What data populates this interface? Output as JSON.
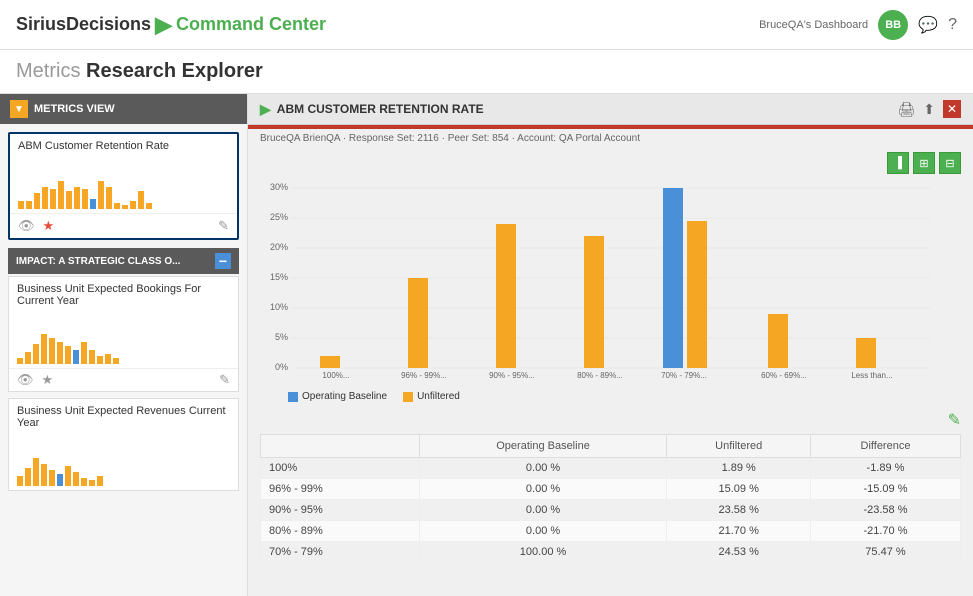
{
  "header": {
    "logo_sirius": "SiriusDecisions",
    "logo_arrow": "▶",
    "logo_command": "Command Center",
    "dashboard_label": "BruceQA's Dashboard",
    "avatar_initials": "BB",
    "chat_icon": "💬",
    "help_icon": "?"
  },
  "page_title": {
    "light": "Metrics ",
    "bold": "Research Explorer"
  },
  "sidebar": {
    "header_label": "METRICS VIEW",
    "metrics": [
      {
        "title": "ABM Customer Retention Rate",
        "selected": true
      }
    ],
    "impact_header": "IMPACT: A STRATEGIC CLASS O...",
    "impact_cards": [
      {
        "title": "Business Unit Expected Bookings For Current Year"
      },
      {
        "title": "Business Unit Expected Revenues Current Year"
      }
    ]
  },
  "panel": {
    "title": "ABM CUSTOMER RETENTION RATE",
    "chart_info": "BruceQA BrienQA · Response Set: 2116 · Peer Set: 854 · Account: QA Portal Account",
    "chart_type_icons": [
      "bar-chart-icon",
      "table-icon",
      "other-chart-icon"
    ],
    "y_axis_labels": [
      "30%",
      "25%",
      "20%",
      "15%",
      "10%",
      "5%",
      "0%"
    ],
    "x_axis_labels": [
      "100%...",
      "96% - 99%...",
      "90% - 95%...",
      "80% - 89%...",
      "70% - 79%...",
      "60% - 69%...",
      "Less than..."
    ],
    "legend": {
      "baseline_label": "Operating Baseline",
      "baseline_color": "#4a90d9",
      "unfiltered_label": "Unfiltered",
      "unfiltered_color": "#f5a623"
    },
    "chart_bars": [
      {
        "category": "100%...",
        "baseline": 0,
        "unfiltered": 2
      },
      {
        "category": "96% - 99%...",
        "baseline": 0,
        "unfiltered": 15
      },
      {
        "category": "90% - 95%...",
        "baseline": 0,
        "unfiltered": 24
      },
      {
        "category": "80% - 89%...",
        "baseline": 0,
        "unfiltered": 22
      },
      {
        "category": "70% - 79%...",
        "baseline": 100,
        "unfiltered": 24.5
      },
      {
        "category": "60% - 69%...",
        "baseline": 0,
        "unfiltered": 9
      },
      {
        "category": "Less than...",
        "baseline": 0,
        "unfiltered": 5
      }
    ],
    "table": {
      "columns": [
        "",
        "Operating Baseline",
        "Unfiltered",
        "Difference"
      ],
      "rows": [
        {
          "label": "100%",
          "baseline": "0.00 %",
          "unfiltered": "1.89 %",
          "difference": "-1.89 %"
        },
        {
          "label": "96% - 99%",
          "baseline": "0.00 %",
          "unfiltered": "15.09 %",
          "difference": "-15.09 %"
        },
        {
          "label": "90% - 95%",
          "baseline": "0.00 %",
          "unfiltered": "23.58 %",
          "difference": "-23.58 %"
        },
        {
          "label": "80% - 89%",
          "baseline": "0.00 %",
          "unfiltered": "21.70 %",
          "difference": "-21.70 %"
        },
        {
          "label": "70% - 79%",
          "baseline": "100.00 %",
          "unfiltered": "24.53 %",
          "difference": "75.47 %"
        }
      ]
    }
  }
}
